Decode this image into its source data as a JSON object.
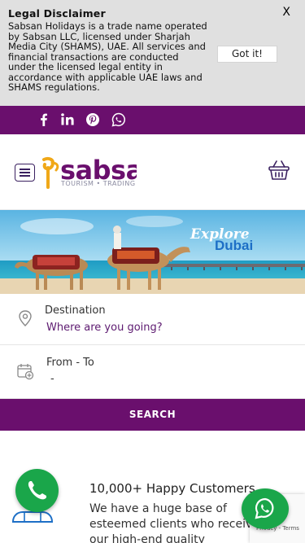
{
  "disclaimer": {
    "title": "Legal Disclaimer",
    "body": "Sabsan Holidays is a trade name operated by Sabsan LLC, licensed under Sharjah Media City (SHAMS), UAE. All services and financial transactions are conducted under the licensed legal entity in accordance with applicable UAE laws and SHAMS regulations.",
    "close_label": "X",
    "button_label": "Got it!"
  },
  "social": {
    "icons": [
      "facebook-icon",
      "linkedin-icon",
      "pinterest-icon",
      "whatsapp-icon"
    ],
    "color": "#6a0f6d"
  },
  "header": {
    "logo_text": "sabsa",
    "logo_tagline": "TOURISM • TRADING •",
    "brand_color": "#6a0f6d"
  },
  "hero": {
    "line1": "Explore",
    "line2": "Dubai"
  },
  "search": {
    "destination_label": "Destination",
    "destination_placeholder": "Where are you going?",
    "dates_label": "From - To",
    "dates_value": "-",
    "button_label": "SEARCH"
  },
  "customers": {
    "title": "10,000+ Happy Customers",
    "text": "We have a huge base of esteemed clients who received our high-end quality"
  },
  "recaptcha": {
    "links": "Privacy - Terms"
  },
  "colors": {
    "accent": "#6a0f6d",
    "whatsapp_green": "#1aa64a",
    "disclaimer_bg": "#e0e0e0"
  }
}
